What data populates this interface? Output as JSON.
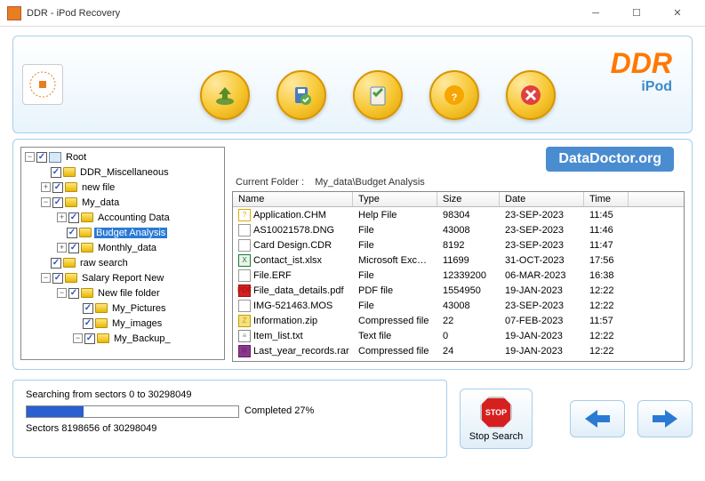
{
  "window": {
    "title": "DDR - iPod Recovery"
  },
  "brand": {
    "ddr": "DDR",
    "sub": "iPod"
  },
  "dataDoctor": "DataDoctor.org",
  "currentFolder": {
    "label": "Current Folder  :",
    "path": "My_data\\Budget Analysis"
  },
  "tree": [
    {
      "depth": 0,
      "exp": "-",
      "chk": true,
      "icon": "pc",
      "label": "Root"
    },
    {
      "depth": 1,
      "exp": "",
      "chk": true,
      "icon": "folder",
      "label": "DDR_Miscellaneous"
    },
    {
      "depth": 1,
      "exp": "+",
      "chk": true,
      "icon": "folder",
      "label": "new file"
    },
    {
      "depth": 1,
      "exp": "-",
      "chk": true,
      "icon": "folder",
      "label": "My_data"
    },
    {
      "depth": 2,
      "exp": "+",
      "chk": true,
      "icon": "folder",
      "label": "Accounting Data"
    },
    {
      "depth": 2,
      "exp": "",
      "chk": true,
      "icon": "folder",
      "label": "Budget Analysis",
      "selected": true
    },
    {
      "depth": 2,
      "exp": "+",
      "chk": true,
      "icon": "folder",
      "label": "Monthly_data"
    },
    {
      "depth": 1,
      "exp": "",
      "chk": true,
      "icon": "folder",
      "label": "raw search"
    },
    {
      "depth": 1,
      "exp": "-",
      "chk": true,
      "icon": "folder",
      "label": "Salary Report New"
    },
    {
      "depth": 2,
      "exp": "-",
      "chk": true,
      "icon": "folder",
      "label": "New file folder"
    },
    {
      "depth": 3,
      "exp": "",
      "chk": true,
      "icon": "folder",
      "label": "My_Pictures"
    },
    {
      "depth": 3,
      "exp": "",
      "chk": true,
      "icon": "folder",
      "label": "My_images"
    },
    {
      "depth": 3,
      "exp": "-",
      "chk": true,
      "icon": "folder",
      "label": "My_Backup_"
    }
  ],
  "columns": {
    "name": "Name",
    "type": "Type",
    "size": "Size",
    "date": "Date",
    "time": "Time"
  },
  "files": [
    {
      "name": "Application.CHM",
      "type": "Help File",
      "size": "98304",
      "date": "23-SEP-2023",
      "time": "11:45",
      "ico": "help"
    },
    {
      "name": "AS10021578.DNG",
      "type": "File",
      "size": "43008",
      "date": "23-SEP-2023",
      "time": "11:46",
      "ico": "file"
    },
    {
      "name": "Card Design.CDR",
      "type": "File",
      "size": "8192",
      "date": "23-SEP-2023",
      "time": "11:47",
      "ico": "file"
    },
    {
      "name": "Contact_ist.xlsx",
      "type": "Microsoft Excel ...",
      "size": "11699",
      "date": "31-OCT-2023",
      "time": "17:56",
      "ico": "xlsx"
    },
    {
      "name": "File.ERF",
      "type": "File",
      "size": "12339200",
      "date": "06-MAR-2023",
      "time": "16:38",
      "ico": "file"
    },
    {
      "name": "File_data_details.pdf",
      "type": "PDF file",
      "size": "1554950",
      "date": "19-JAN-2023",
      "time": "12:22",
      "ico": "pdf"
    },
    {
      "name": "IMG-521463.MOS",
      "type": "File",
      "size": "43008",
      "date": "23-SEP-2023",
      "time": "12:22",
      "ico": "file"
    },
    {
      "name": "Information.zip",
      "type": "Compressed file",
      "size": "22",
      "date": "07-FEB-2023",
      "time": "11:57",
      "ico": "zip"
    },
    {
      "name": "Item_list.txt",
      "type": "Text file",
      "size": "0",
      "date": "19-JAN-2023",
      "time": "12:22",
      "ico": "txt"
    },
    {
      "name": "Last_year_records.rar",
      "type": "Compressed file",
      "size": "24",
      "date": "19-JAN-2023",
      "time": "12:22",
      "ico": "rar"
    }
  ],
  "progress": {
    "searching": "Searching from sectors  0 to 30298049",
    "completed": "Completed 27%",
    "sectors": "Sectors  8198656 of 30298049",
    "pct": 27
  },
  "stop": {
    "label": "Stop Search",
    "sign": "STOP"
  }
}
